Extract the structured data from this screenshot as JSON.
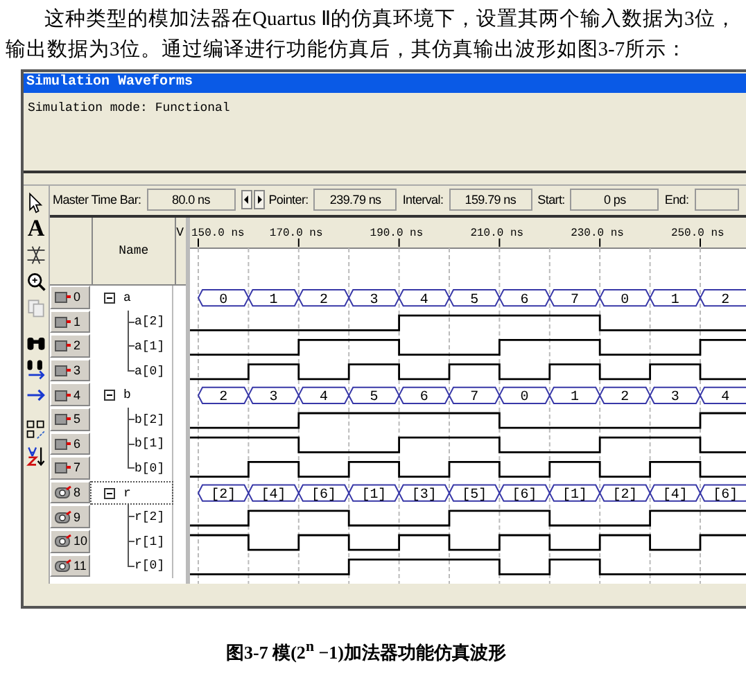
{
  "paragraph": "这种类型的模加法器在Quartus Ⅱ的仿真环境下，设置其两个输入数据为3位，输出数据为3位。通过编译进行功能仿真后，其仿真输出波形如图3-7所示：",
  "window": {
    "title": "Simulation Waveforms",
    "mode": "Simulation mode: Functional"
  },
  "time_bar": {
    "master_label": "Master Time Bar:",
    "master_value": "80.0 ns",
    "pointer_label": "Pointer:",
    "pointer_value": "239.79 ns",
    "interval_label": "Interval:",
    "interval_value": "159.79 ns",
    "start_label": "Start:",
    "start_value": "0 ps",
    "end_label": "End:"
  },
  "text_tool": "A",
  "columns": {
    "name": "Name",
    "value": "V"
  },
  "ruler": [
    "150.0 ns",
    "170.0 ns",
    "190.0 ns",
    "210.0 ns",
    "230.0 ns",
    "250.0 ns"
  ],
  "signals": [
    {
      "index": "0",
      "name": "a",
      "kind": "input",
      "expanded": true,
      "selected": false,
      "values": [
        "0",
        "1",
        "2",
        "3",
        "4",
        "5",
        "6",
        "7",
        "0",
        "1",
        "2"
      ],
      "children": [
        {
          "index": "1",
          "name": "a[2]",
          "kind": "input",
          "selected": false
        },
        {
          "index": "2",
          "name": "a[1]",
          "kind": "input",
          "selected": false
        },
        {
          "index": "3",
          "name": "a[0]",
          "kind": "input",
          "selected": false
        }
      ]
    },
    {
      "index": "4",
      "name": "b",
      "kind": "input",
      "expanded": true,
      "selected": false,
      "values": [
        "2",
        "3",
        "4",
        "5",
        "6",
        "7",
        "0",
        "1",
        "2",
        "3",
        "4"
      ],
      "children": [
        {
          "index": "5",
          "name": "b[2]",
          "kind": "input",
          "selected": false
        },
        {
          "index": "6",
          "name": "b[1]",
          "kind": "input",
          "selected": false
        },
        {
          "index": "7",
          "name": "b[0]",
          "kind": "input",
          "selected": false
        }
      ]
    },
    {
      "index": "8",
      "name": "r",
      "kind": "output",
      "expanded": true,
      "selected": true,
      "values": [
        "[2]",
        "[4]",
        "[6]",
        "[1]",
        "[3]",
        "[5]",
        "[6]",
        "[1]",
        "[2]",
        "[4]",
        "[6]"
      ],
      "children": [
        {
          "index": "9",
          "name": "r[2]",
          "kind": "output",
          "selected": false
        },
        {
          "index": "10",
          "name": "r[1]",
          "kind": "output",
          "selected": false
        },
        {
          "index": "11",
          "name": "r[0]",
          "kind": "output",
          "selected": false
        }
      ]
    }
  ],
  "caption": "图3-7  模(2$^{n}$ −1)加法器功能仿真波形"
}
